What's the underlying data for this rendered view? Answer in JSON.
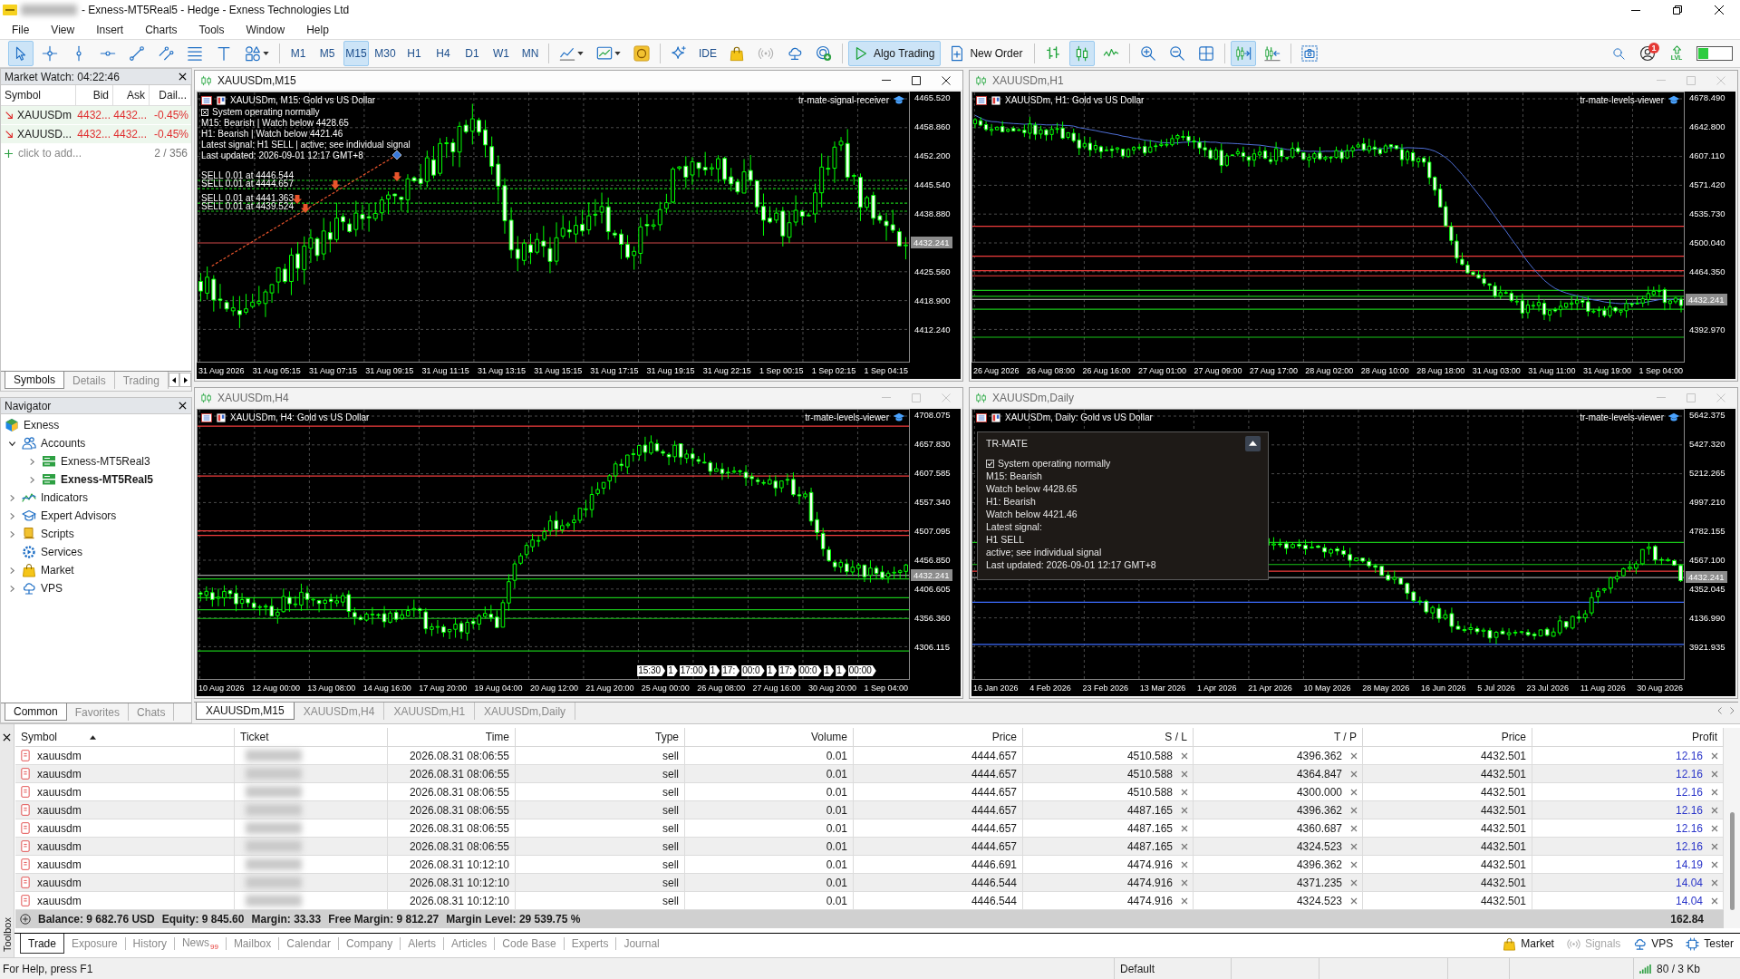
{
  "window": {
    "title": "- Exness-MT5Real5 - Hedge - Exness Technologies Ltd"
  },
  "menu": [
    "File",
    "View",
    "Insert",
    "Charts",
    "Tools",
    "Window",
    "Help"
  ],
  "toolbar": {
    "drawing_tools": [
      {
        "selected": true
      },
      {
        "selected": false
      },
      {
        "selected": false
      },
      {
        "selected": false
      },
      {
        "selected": false
      },
      {
        "selected": false
      },
      {
        "selected": false
      },
      {
        "selected": false
      },
      {
        "selected": false
      }
    ],
    "timeframes": [
      {
        "label": "M1",
        "selected": false
      },
      {
        "label": "M5",
        "selected": false
      },
      {
        "label": "M15",
        "selected": true
      },
      {
        "label": "M30",
        "selected": false
      },
      {
        "label": "H1",
        "selected": false
      },
      {
        "label": "H4",
        "selected": false
      },
      {
        "label": "D1",
        "selected": false
      },
      {
        "label": "W1",
        "selected": false
      },
      {
        "label": "MN",
        "selected": false
      }
    ],
    "ide": "IDE",
    "algo_trading": {
      "label": "Algo Trading",
      "on": true
    },
    "new_order": "New Order",
    "chart_types": [
      {
        "selected": false
      },
      {
        "selected": true
      },
      {
        "selected": false
      }
    ],
    "scrolling": [
      {
        "selected": true
      },
      {
        "selected": false
      }
    ],
    "notifications": "1",
    "level_label": "LVL"
  },
  "market_watch": {
    "title": "Market Watch: 04:22:46",
    "columns": [
      "Symbol",
      "Bid",
      "Ask",
      "Dail..."
    ],
    "rows": [
      {
        "symbol": "XAUUSDm",
        "bid": "4432...",
        "ask": "4432...",
        "daily": "-0.45%",
        "falling": true
      },
      {
        "symbol": "XAUUSD...",
        "bid": "4432...",
        "ask": "4432...",
        "daily": "-0.45%",
        "falling": true
      }
    ],
    "add_hint": "click to add...",
    "count": "2 / 356",
    "tabs": [
      {
        "label": "Symbols",
        "selected": true
      },
      {
        "label": "Details",
        "selected": false
      },
      {
        "label": "Trading",
        "selected": false
      }
    ]
  },
  "navigator": {
    "title": "Navigator",
    "tree": [
      {
        "label": "Exness",
        "kind": "broker",
        "children": [
          {
            "label": "Accounts",
            "kind": "accounts",
            "expanded": true,
            "children": [
              {
                "label": "Exness-MT5Real3",
                "kind": "account",
                "expanded": false,
                "active": false
              },
              {
                "label": "Exness-MT5Real5",
                "kind": "account",
                "expanded": false,
                "active": true
              }
            ]
          },
          {
            "label": "Indicators",
            "kind": "indicators",
            "expanded": false
          },
          {
            "label": "Expert Advisors",
            "kind": "experts",
            "expanded": false
          },
          {
            "label": "Scripts",
            "kind": "scripts",
            "expanded": false
          },
          {
            "label": "Services",
            "kind": "services"
          },
          {
            "label": "Market",
            "kind": "market",
            "expanded": false
          },
          {
            "label": "VPS",
            "kind": "vps",
            "expanded": false
          }
        ]
      }
    ],
    "tabs": [
      {
        "label": "Common",
        "selected": true
      },
      {
        "label": "Favorites",
        "selected": false
      },
      {
        "label": "Chats",
        "selected": false
      }
    ]
  },
  "charts": [
    {
      "title": "XAUUSDm,M15",
      "active": true,
      "caption": "XAUUSDm, M15: Gold vs US Dollar",
      "expert": "tr-mate-signal-receiver",
      "price_labels": [
        "4465.520",
        "4458.860",
        "4452.200",
        "4445.540",
        "4438.880",
        "4425.560",
        "4418.900",
        "4412.240"
      ],
      "current_price": "4432.241",
      "time_labels": [
        "31 Aug 2026",
        "31 Aug 05:15",
        "31 Aug 07:15",
        "31 Aug 09:15",
        "31 Aug 11:15",
        "31 Aug 13:15",
        "31 Aug 15:15",
        "31 Aug 17:15",
        "31 Aug 19:15",
        "31 Aug 22:15",
        "1 Sep 00:15",
        "1 Sep 02:15",
        "1 Sep 04:15"
      ],
      "comment": {
        "status": {
          "label": "System operating normally",
          "checked": true
        },
        "lines": [
          "M15: Bearish | Watch below 4428.65",
          "H1: Bearish | Watch below 4421.46",
          "Latest signal: H1 SELL | active; see individual signal",
          "Last updated: 2026-09-01 12:17 GMT+8"
        ]
      },
      "order_labels": [
        "SELL 0.01 at 4446.544",
        "SELL 0.01 at 4444.657",
        "SELL 0.01 at 4441.363",
        "SELL 0.01 at 4439.524"
      ]
    },
    {
      "title": "XAUUSDm,H1",
      "active": false,
      "caption": "XAUUSDm, H1: Gold vs US Dollar",
      "expert": "tr-mate-levels-viewer",
      "price_labels": [
        "4678.490",
        "4642.800",
        "4607.110",
        "4571.420",
        "4535.730",
        "4500.040",
        "4464.350",
        "4392.970"
      ],
      "current_price": "4432.241",
      "time_labels": [
        "26 Aug 2026",
        "26 Aug 08:00",
        "26 Aug 16:00",
        "27 Aug 01:00",
        "27 Aug 09:00",
        "27 Aug 17:00",
        "28 Aug 02:00",
        "28 Aug 10:00",
        "28 Aug 18:00",
        "31 Aug 03:00",
        "31 Aug 11:00",
        "31 Aug 19:00",
        "1 Sep 04:00"
      ]
    },
    {
      "title": "XAUUSDm,H4",
      "active": false,
      "caption": "XAUUSDm, H4: Gold vs US Dollar",
      "expert": "tr-mate-levels-viewer",
      "price_labels": [
        "4708.075",
        "4657.830",
        "4607.585",
        "4557.340",
        "4507.095",
        "4456.850",
        "4406.605",
        "4356.360",
        "4306.115"
      ],
      "current_price": "4432.241",
      "time_labels": [
        "10 Aug 2026",
        "12 Aug 00:00",
        "13 Aug 08:00",
        "14 Aug 16:00",
        "17 Aug 20:00",
        "19 Aug 04:00",
        "20 Aug 12:00",
        "21 Aug 20:00",
        "25 Aug 00:00",
        "26 Aug 08:00",
        "27 Aug 16:00",
        "30 Aug 20:00",
        "1 Sep 04:00"
      ],
      "marker_labels": [
        "15:30",
        "1",
        "17:00",
        "1",
        "17:",
        "00:0",
        "1",
        "17:",
        "00:0",
        "1",
        "1",
        "00:00"
      ]
    },
    {
      "title": "XAUUSDm,Daily",
      "active": false,
      "caption": "XAUUSDm, Daily: Gold vs US Dollar",
      "expert": "tr-mate-levels-viewer",
      "price_labels": [
        "5642.375",
        "5427.320",
        "5212.265",
        "4997.210",
        "4782.155",
        "4567.100",
        "4352.045",
        "4136.990",
        "3921.935"
      ],
      "current_price": "4432.241",
      "time_labels": [
        "16 Jan 2026",
        "4 Feb 2026",
        "23 Feb 2026",
        "13 Mar 2026",
        "1 Apr 2026",
        "21 Apr 2026",
        "10 May 2026",
        "28 May 2026",
        "16 Jun 2026",
        "5 Jul 2026",
        "23 Jul 2026",
        "11 Aug 2026",
        "30 Aug 2026"
      ],
      "panel": {
        "title": "TR-MATE",
        "status": {
          "label": "System operating normally",
          "checked": true
        },
        "lines": [
          "M15: Bearish",
          "Watch below 4428.65",
          "H1: Bearish",
          "Watch below 4421.46",
          "Latest signal:",
          "H1 SELL",
          "active; see individual signal",
          "Last updated: 2026-09-01 12:17 GMT+8"
        ]
      }
    }
  ],
  "chart_tabs": [
    {
      "label": "XAUUSDm,M15",
      "selected": true
    },
    {
      "label": "XAUUSDm,H4",
      "selected": false
    },
    {
      "label": "XAUUSDm,H1",
      "selected": false
    },
    {
      "label": "XAUUSDm,Daily",
      "selected": false
    }
  ],
  "toolbox": {
    "label": "Toolbox",
    "columns": [
      {
        "label": "Symbol",
        "sorted": true
      },
      {
        "label": "Ticket",
        "sorted": false
      },
      {
        "label": "Time",
        "sorted": false
      },
      {
        "label": "Type",
        "sorted": false
      },
      {
        "label": "Volume",
        "sorted": false
      },
      {
        "label": "Price",
        "sorted": false
      },
      {
        "label": "S / L",
        "sorted": false
      },
      {
        "label": "T / P",
        "sorted": false
      },
      {
        "label": "Price",
        "sorted": false
      },
      {
        "label": "Profit",
        "sorted": false
      }
    ],
    "rows": [
      {
        "symbol": "xauusdm",
        "time": "2026.08.31 08:06:55",
        "type": "sell",
        "volume": "0.01",
        "open_price": "4444.657",
        "sl": "4510.588",
        "tp": "4396.362",
        "price": "4432.501",
        "profit": "12.16"
      },
      {
        "symbol": "xauusdm",
        "time": "2026.08.31 08:06:55",
        "type": "sell",
        "volume": "0.01",
        "open_price": "4444.657",
        "sl": "4510.588",
        "tp": "4364.847",
        "price": "4432.501",
        "profit": "12.16"
      },
      {
        "symbol": "xauusdm",
        "time": "2026.08.31 08:06:55",
        "type": "sell",
        "volume": "0.01",
        "open_price": "4444.657",
        "sl": "4510.588",
        "tp": "4300.000",
        "price": "4432.501",
        "profit": "12.16"
      },
      {
        "symbol": "xauusdm",
        "time": "2026.08.31 08:06:55",
        "type": "sell",
        "volume": "0.01",
        "open_price": "4444.657",
        "sl": "4487.165",
        "tp": "4396.362",
        "price": "4432.501",
        "profit": "12.16"
      },
      {
        "symbol": "xauusdm",
        "time": "2026.08.31 08:06:55",
        "type": "sell",
        "volume": "0.01",
        "open_price": "4444.657",
        "sl": "4487.165",
        "tp": "4360.687",
        "price": "4432.501",
        "profit": "12.16"
      },
      {
        "symbol": "xauusdm",
        "time": "2026.08.31 08:06:55",
        "type": "sell",
        "volume": "0.01",
        "open_price": "4444.657",
        "sl": "4487.165",
        "tp": "4324.523",
        "price": "4432.501",
        "profit": "12.16"
      },
      {
        "symbol": "xauusdm",
        "time": "2026.08.31 10:12:10",
        "type": "sell",
        "volume": "0.01",
        "open_price": "4446.691",
        "sl": "4474.916",
        "tp": "4396.362",
        "price": "4432.501",
        "profit": "14.19"
      },
      {
        "symbol": "xauusdm",
        "time": "2026.08.31 10:12:10",
        "type": "sell",
        "volume": "0.01",
        "open_price": "4446.544",
        "sl": "4474.916",
        "tp": "4371.235",
        "price": "4432.501",
        "profit": "14.04"
      },
      {
        "symbol": "xauusdm",
        "time": "2026.08.31 10:12:10",
        "type": "sell",
        "volume": "0.01",
        "open_price": "4446.544",
        "sl": "4474.916",
        "tp": "4324.523",
        "price": "4432.501",
        "profit": "14.04"
      }
    ],
    "summary": [
      "Balance: 9 682.76 USD",
      "Equity: 9 845.60",
      "Margin: 33.33",
      "Free Margin: 9 812.27",
      "Margin Level: 29 539.75 %"
    ],
    "total": "162.84",
    "tabs": [
      {
        "label": "Trade",
        "selected": true
      },
      {
        "label": "Exposure",
        "selected": false
      },
      {
        "label": "History",
        "selected": false
      },
      {
        "label": "News",
        "selected": false,
        "badge": "99"
      },
      {
        "label": "Mailbox",
        "selected": false
      },
      {
        "label": "Calendar",
        "selected": false
      },
      {
        "label": "Company",
        "selected": false
      },
      {
        "label": "Alerts",
        "selected": false
      },
      {
        "label": "Articles",
        "selected": false
      },
      {
        "label": "Code Base",
        "selected": false
      },
      {
        "label": "Experts",
        "selected": false
      },
      {
        "label": "Journal",
        "selected": false
      }
    ],
    "services": [
      {
        "kind": "market",
        "label": "Market",
        "disabled": false
      },
      {
        "kind": "signals",
        "label": "Signals",
        "disabled": true
      },
      {
        "kind": "vps",
        "label": "VPS",
        "disabled": false
      },
      {
        "kind": "tester",
        "label": "Tester",
        "disabled": false
      }
    ]
  },
  "status_bar": {
    "help": "For Help, press F1",
    "profile": "Default",
    "traffic": "80 / 3 Kb"
  }
}
